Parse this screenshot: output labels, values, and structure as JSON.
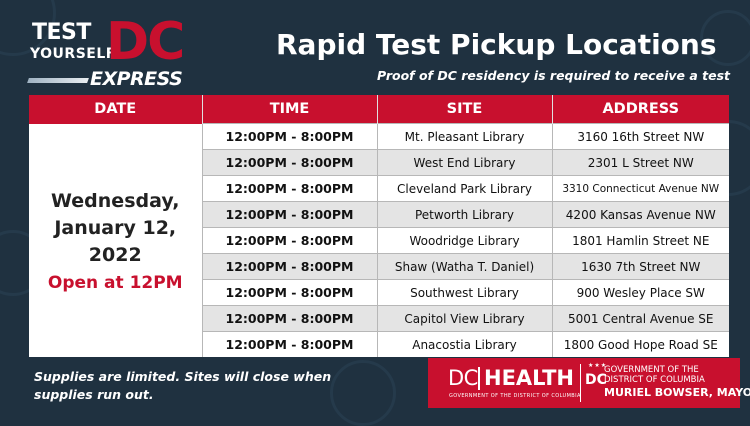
{
  "logo": {
    "line1": "TEST",
    "line2": "YOURSELF",
    "dc": "DC",
    "express": "EXPRESS"
  },
  "title": "Rapid Test Pickup Locations",
  "subtitle": "Proof of DC residency is required to receive a test",
  "table": {
    "headers": [
      "DATE",
      "TIME",
      "SITE",
      "ADDRESS"
    ],
    "date_lines": [
      "Wednesday,",
      "January 12,",
      "2022"
    ],
    "open_text": "Open at 12PM",
    "rows": [
      {
        "time": "12:00PM - 8:00PM",
        "site": "Mt. Pleasant Library",
        "address": "3160 16th Street NW"
      },
      {
        "time": "12:00PM - 8:00PM",
        "site": "West End Library",
        "address": "2301 L Street NW"
      },
      {
        "time": "12:00PM - 8:00PM",
        "site": "Cleveland Park Library",
        "address": "3310 Connecticut Avenue NW"
      },
      {
        "time": "12:00PM - 8:00PM",
        "site": "Petworth Library",
        "address": "4200 Kansas Avenue NW"
      },
      {
        "time": "12:00PM - 8:00PM",
        "site": "Woodridge Library",
        "address": "1801 Hamlin Street NE"
      },
      {
        "time": "12:00PM - 8:00PM",
        "site": "Shaw (Watha T. Daniel)",
        "address": "1630 7th Street NW"
      },
      {
        "time": "12:00PM - 8:00PM",
        "site": "Southwest Library",
        "address": "900 Wesley Place SW"
      },
      {
        "time": "12:00PM - 8:00PM",
        "site": "Capitol View Library",
        "address": "5001 Central Avenue SE"
      },
      {
        "time": "12:00PM - 8:00PM",
        "site": "Anacostia Library",
        "address": "1800 Good Hope Road SE"
      }
    ]
  },
  "footer_note": "Supplies are limited. Sites will close when supplies run out.",
  "dc_health": {
    "dc": "DC",
    "health": "HEALTH",
    "sub": "GOVERNMENT OF THE DISTRICT OF COLUMBIA",
    "gov_dc": "DC",
    "gov_line1": "GOVERNMENT OF THE",
    "gov_line2": "DISTRICT OF COLUMBIA",
    "mayor": "MURIEL BOWSER, MAYOR"
  },
  "colors": {
    "background": "#1f3140",
    "accent_red": "#c8102e",
    "row_alt": "#e4e4e4"
  }
}
